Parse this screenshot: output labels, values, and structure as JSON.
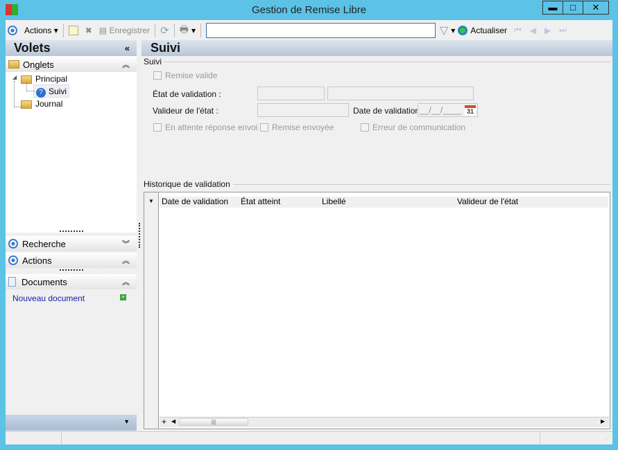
{
  "window": {
    "title": "Gestion de Remise Libre",
    "buttons": [
      "minimize",
      "maximize",
      "close"
    ]
  },
  "toolbar": {
    "actions": "Actions",
    "save": "Enregistrer",
    "search_value": "",
    "refresh": "Actualiser"
  },
  "left": {
    "title": "Volets",
    "onglets": "Onglets",
    "tree": [
      {
        "label": "Principal"
      },
      {
        "label": "Suivi"
      },
      {
        "label": "Journal"
      }
    ],
    "recherche": "Recherche",
    "actions": "Actions",
    "documents": "Documents",
    "new_document": "Nouveau document"
  },
  "main": {
    "title": "Suivi",
    "group": "Suivi",
    "remise_valide": "Remise valide",
    "etat_label": "État de validation :",
    "etat_code": "",
    "etat_lib": "",
    "valideur_label": "Valideur de l'état :",
    "valideur": "",
    "date_label": "Date de validation :",
    "date_value": "__/__/____",
    "en_attente": "En attente réponse envoi",
    "remise_envoyee": "Remise envoyée",
    "erreur": "Erreur de communication",
    "historique": "Historique de validation",
    "columns": [
      "Date de validation",
      "État atteint",
      "Libellé",
      "Valideur de l'état"
    ]
  },
  "colors": {
    "frame": "#5cc2e6",
    "link": "#1a1aa6"
  }
}
